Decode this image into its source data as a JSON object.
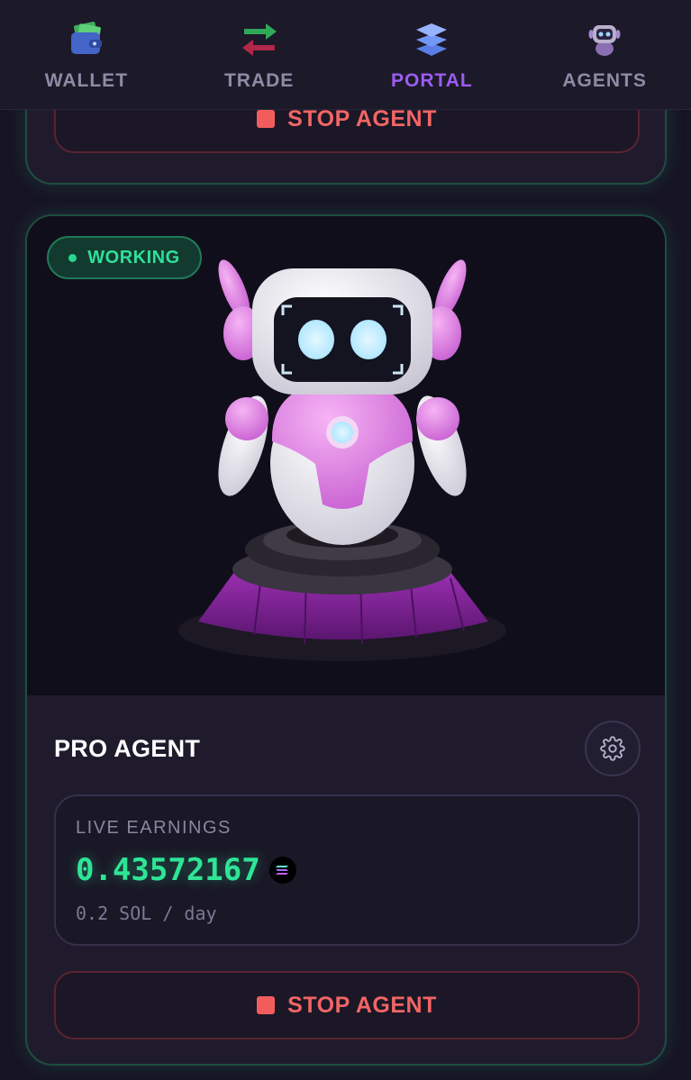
{
  "nav": {
    "items": [
      {
        "label": "WALLET",
        "icon": "wallet-icon"
      },
      {
        "label": "TRADE",
        "icon": "trade-arrows-icon"
      },
      {
        "label": "PORTAL",
        "icon": "portal-layers-icon",
        "active": true
      },
      {
        "label": "AGENTS",
        "icon": "robot-icon"
      }
    ]
  },
  "prev_card": {
    "stop_label": "STOP AGENT"
  },
  "agent_card": {
    "status": "WORKING",
    "name": "PRO AGENT",
    "earnings_label": "LIVE EARNINGS",
    "earnings_value": "0.43572167",
    "currency_icon": "solana-icon",
    "rate": "0.2 SOL / day",
    "stop_label": "STOP AGENT"
  },
  "colors": {
    "accent_active": "#9c5cf0",
    "earnings_green": "#2ee596",
    "stop_red": "#f26565",
    "card_border": "#1f4d3f"
  }
}
